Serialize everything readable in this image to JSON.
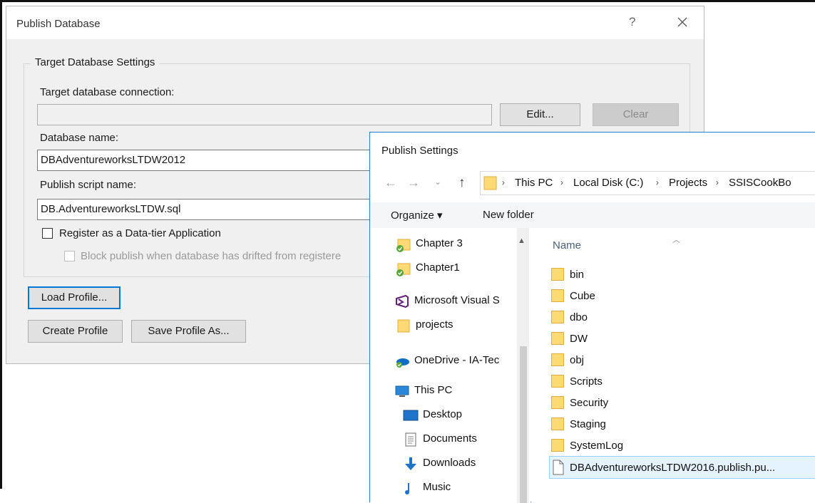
{
  "publish_db": {
    "title": "Publish Database",
    "help": "?",
    "group_title": "Target Database Settings",
    "connection_label": "Target database connection:",
    "connection_value": "",
    "edit_button": "Edit...",
    "clear_button": "Clear",
    "dbname_label": "Database name:",
    "dbname_value": "DBAdventureworksLTDW2012",
    "script_label": "Publish script name:",
    "script_value": "DB.AdventureworksLTDW.sql",
    "register_label": "Register as a Data-tier Application",
    "block_label": "Block publish when database has drifted from registere",
    "load_profile_button": "Load Profile...",
    "create_profile_button": "Create Profile",
    "save_profile_button": "Save Profile As..."
  },
  "publish_settings": {
    "title": "Publish Settings",
    "breadcrumb": [
      "This PC",
      "Local Disk (C:)",
      "Projects",
      "SSISCookBo"
    ],
    "organize": "Organize ▾",
    "new_folder": "New folder",
    "nav_items": [
      {
        "label": "Chapter 3",
        "icon": "folder-sync-icon"
      },
      {
        "label": "Chapter1",
        "icon": "folder-sync-icon"
      },
      {
        "label": "Microsoft Visual S",
        "icon": "visual-studio-icon"
      },
      {
        "label": "projects",
        "icon": "folder-icon"
      },
      {
        "label": "OneDrive - IA-Tec",
        "icon": "onedrive-icon"
      },
      {
        "label": "This PC",
        "icon": "computer-icon"
      },
      {
        "label": "Desktop",
        "icon": "desktop-icon"
      },
      {
        "label": "Documents",
        "icon": "documents-icon"
      },
      {
        "label": "Downloads",
        "icon": "downloads-icon"
      },
      {
        "label": "Music",
        "icon": "music-icon"
      }
    ],
    "column_name": "Name",
    "files": [
      {
        "label": "bin",
        "type": "folder"
      },
      {
        "label": "Cube",
        "type": "folder"
      },
      {
        "label": "dbo",
        "type": "folder"
      },
      {
        "label": "DW",
        "type": "folder"
      },
      {
        "label": "obj",
        "type": "folder"
      },
      {
        "label": "Scripts",
        "type": "folder"
      },
      {
        "label": "Security",
        "type": "folder"
      },
      {
        "label": "Staging",
        "type": "folder"
      },
      {
        "label": "SystemLog",
        "type": "folder"
      },
      {
        "label": "DBAdventureworksLTDW2016.publish.pu...",
        "type": "file"
      }
    ]
  }
}
